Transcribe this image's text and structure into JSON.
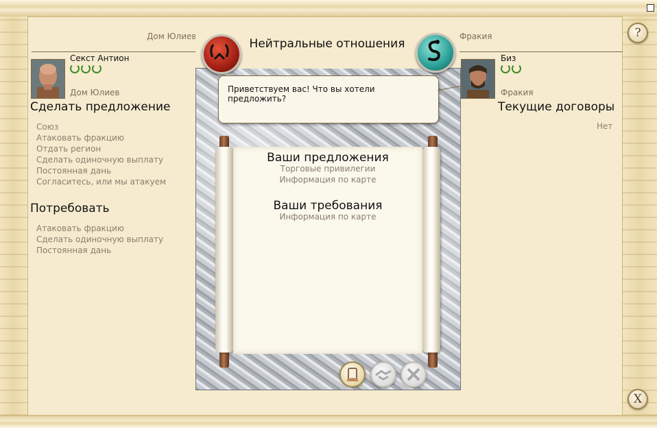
{
  "header": {
    "title": "Нейтральные отношения"
  },
  "player": {
    "faction": "Дом Юлиев",
    "name": "Секст Антион",
    "faction_small": "Дом Юлиев",
    "rank_count": 3
  },
  "other": {
    "faction": "Фракия",
    "name": "Биз",
    "faction_small": "Фракия",
    "rank_count": 2
  },
  "speech": {
    "text": "Приветствуем вас! Что вы хотели предложить?"
  },
  "offer": {
    "title": "Сделать предложение",
    "options": [
      "Союз",
      "Атаковать фракцию",
      "Отдать регион",
      "Сделать одиночную выплату",
      "Постоянная дань",
      "Согласитесь, или мы атакуем"
    ]
  },
  "demand": {
    "title": "Потребовать",
    "options": [
      "Атаковать фракцию",
      "Сделать одиночную выплату",
      "Постоянная дань"
    ]
  },
  "treaties": {
    "title": "Текущие договоры",
    "value": "Нет"
  },
  "scroll": {
    "proposals_title": "Ваши предложения",
    "proposals": [
      "Торговые привилегии",
      "Информация по карте"
    ],
    "demands_title": "Ваши требования",
    "demands": [
      "Информация по карте"
    ]
  },
  "buttons": {
    "help": "?",
    "close": "X"
  },
  "colors": {
    "background": "#f6ebcf",
    "muted_text": "#8a7f6d",
    "player_medal": "#a21f14",
    "other_medal": "#2a9f96"
  },
  "icons": {
    "player_emblem": "laurel-wreath-icon",
    "other_emblem": "serpent-icon",
    "propose": "hand-scroll-icon",
    "handshake": "handshake-icon",
    "reject": "crossed-hands-icon"
  }
}
